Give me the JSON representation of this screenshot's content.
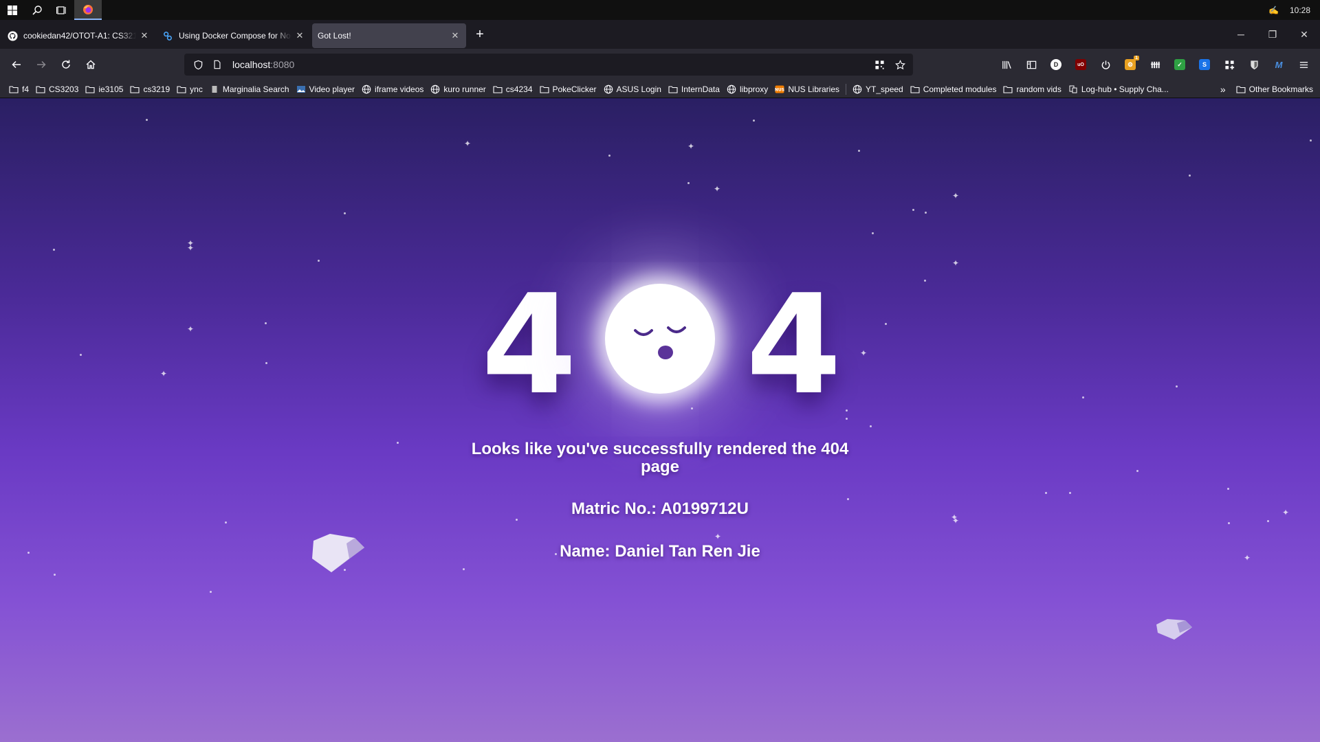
{
  "taskbar": {
    "clock": "10:28"
  },
  "tabs": [
    {
      "label": "cookiedan42/OTOT-A1: CS3219",
      "icon": "github-icon",
      "active": false
    },
    {
      "label": "Using Docker Compose for Nod",
      "icon": "docker-icon",
      "active": false
    },
    {
      "label": "Got Lost!",
      "icon": "none",
      "active": true
    }
  ],
  "navbar": {
    "url_host": "localhost",
    "url_port": ":8080"
  },
  "bookmarks": [
    {
      "label": "f4",
      "icon": "folder-icon"
    },
    {
      "label": "CS3203",
      "icon": "folder-icon"
    },
    {
      "label": "ie3105",
      "icon": "folder-icon"
    },
    {
      "label": "cs3219",
      "icon": "folder-icon"
    },
    {
      "label": "ync",
      "icon": "folder-icon"
    },
    {
      "label": "Marginalia Search",
      "icon": "page-icon"
    },
    {
      "label": "Video player",
      "icon": "image-icon"
    },
    {
      "label": "iframe videos",
      "icon": "globe-icon"
    },
    {
      "label": "kuro runner",
      "icon": "globe-icon"
    },
    {
      "label": "cs4234",
      "icon": "folder-icon"
    },
    {
      "label": "PokeClicker",
      "icon": "folder-icon"
    },
    {
      "label": "ASUS Login",
      "icon": "globe-icon"
    },
    {
      "label": "InternData",
      "icon": "folder-icon"
    },
    {
      "label": "libproxy",
      "icon": "globe-icon"
    },
    {
      "label": "NUS Libraries",
      "icon": "nus-icon"
    },
    {
      "label": "YT_speed",
      "icon": "globe-icon"
    },
    {
      "label": "Completed modules",
      "icon": "folder-icon"
    },
    {
      "label": "random vids",
      "icon": "folder-icon"
    },
    {
      "label": "Log-hub • Supply Cha...",
      "icon": "log-icon"
    }
  ],
  "bookmarks_other": "Other Bookmarks",
  "page": {
    "digit_left": "4",
    "digit_right": "4",
    "message": "Looks like you've successfully rendered the 404 page",
    "matric": "Matric No.: A0199712U",
    "name": "Name: Daniel Tan Ren Jie"
  }
}
